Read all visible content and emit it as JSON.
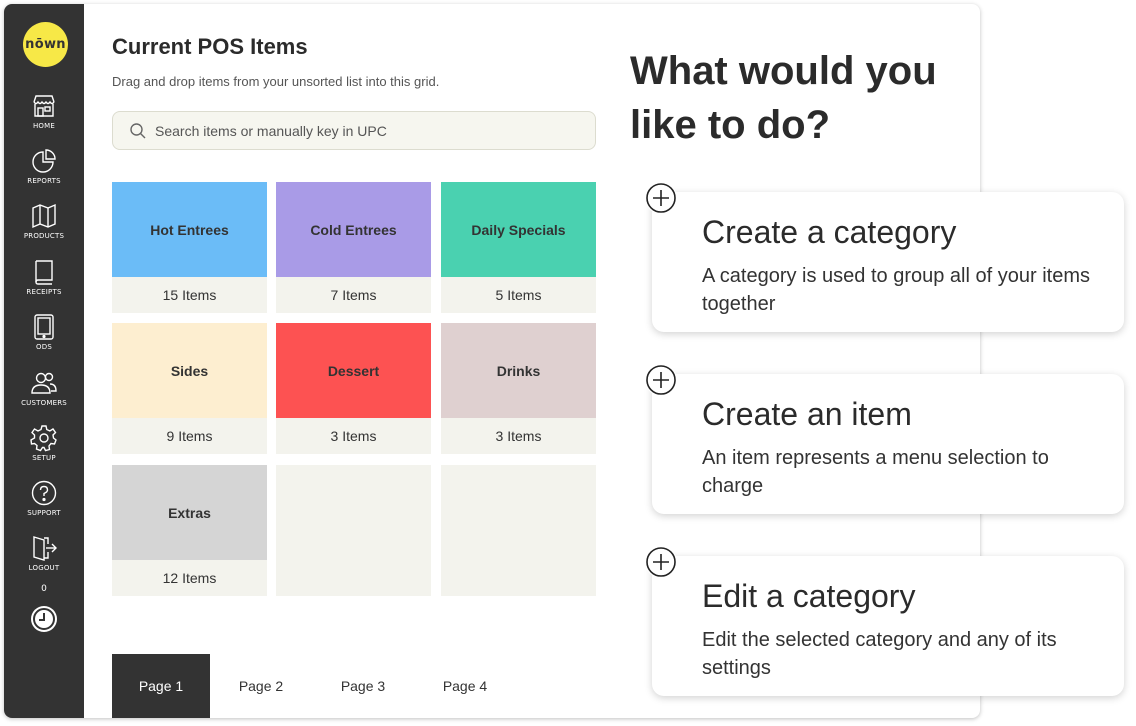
{
  "brand": {
    "logo_text": "nōwn",
    "logo_color": "#f7e847"
  },
  "sidebar": {
    "items": [
      {
        "label": "HOME",
        "icon": "storefront-icon"
      },
      {
        "label": "REPORTS",
        "icon": "pie-chart-icon"
      },
      {
        "label": "PRODUCTS",
        "icon": "map-icon"
      },
      {
        "label": "RECEIPTS",
        "icon": "book-icon"
      },
      {
        "label": "ODS",
        "icon": "tablet-icon"
      },
      {
        "label": "CUSTOMERS",
        "icon": "users-icon"
      },
      {
        "label": "SETUP",
        "icon": "gear-icon"
      },
      {
        "label": "SUPPORT",
        "icon": "question-icon"
      },
      {
        "label": "LOGOUT",
        "icon": "logout-icon"
      }
    ],
    "clock_count": "0"
  },
  "main": {
    "title": "Current POS Items",
    "subtitle": "Drag and drop items from your unsorted list into this grid.",
    "search_placeholder": "Search items or manually key in UPC",
    "categories": [
      {
        "name": "Hot Entrees",
        "count": "15 Items",
        "color": "#6bbcf7"
      },
      {
        "name": "Cold Entrees",
        "count": "7 Items",
        "color": "#a99be7"
      },
      {
        "name": "Daily Specials",
        "count": "5 Items",
        "color": "#4ad1b0"
      },
      {
        "name": "Sides",
        "count": "9 Items",
        "color": "#fdeed0"
      },
      {
        "name": "Dessert",
        "count": "3 Items",
        "color": "#fd5252"
      },
      {
        "name": "Drinks",
        "count": "3 Items",
        "color": "#dfd0d0"
      },
      {
        "name": "Extras",
        "count": "12 Items",
        "color": "#d5d5d5"
      }
    ],
    "pages": [
      "Page 1",
      "Page 2",
      "Page 3",
      "Page 4"
    ]
  },
  "actions": {
    "heading": "What would you like to do?",
    "cards": [
      {
        "title": "Create a category",
        "description": "A category is used to group all of your items together"
      },
      {
        "title": "Create an item",
        "description": "An item represents a menu selection to charge"
      },
      {
        "title": "Edit a category",
        "description": "Edit the selected category and any of its settings"
      }
    ]
  }
}
